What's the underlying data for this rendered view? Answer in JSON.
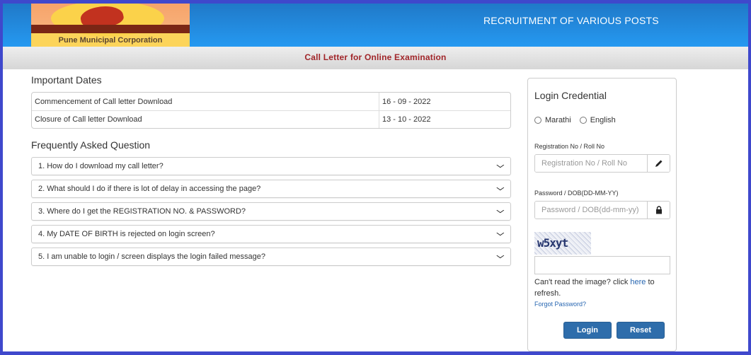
{
  "header": {
    "logo_caption": "Pune Municipal Corporation",
    "title": "RECRUITMENT OF VARIOUS POSTS"
  },
  "subbar": {
    "title": "Call Letter for Online Examination"
  },
  "important_dates": {
    "heading": "Important Dates",
    "rows": [
      {
        "label": "Commencement of Call letter Download",
        "date": "16 - 09 - 2022"
      },
      {
        "label": "Closure of Call letter Download",
        "date": "13 - 10 - 2022"
      }
    ]
  },
  "faq": {
    "heading": "Frequently Asked Question",
    "items": [
      {
        "question": "1. How do I download my call letter?",
        "icon": "chevron-down-icon"
      },
      {
        "question": "2. What should I do if there is lot of delay in accessing the page?",
        "icon": "chevron-down-icon"
      },
      {
        "question": "3. Where do I get the REGISTRATION NO. & PASSWORD?",
        "icon": "chevron-down-icon"
      },
      {
        "question": "4. My DATE OF BIRTH is rejected on login screen?",
        "icon": "chevron-down-icon"
      },
      {
        "question": "5. I am unable to login / screen displays the login failed message?",
        "icon": "chevron-down-icon"
      }
    ]
  },
  "login": {
    "heading": "Login Credential",
    "languages": [
      "Marathi",
      "English"
    ],
    "registration": {
      "label": "Registration No / Roll No",
      "placeholder": "Registration No / Roll No",
      "value": "",
      "icon": "pencil-icon"
    },
    "password": {
      "label": "Password / DOB(DD-MM-YY)",
      "placeholder": "Password / DOB(dd-mm-yy)",
      "value": "",
      "icon": "lock-icon"
    },
    "captcha_text": "w5xyt",
    "captcha_value": "",
    "help_prefix": "Can't read the image? click ",
    "help_link": "here",
    "help_suffix": " to refresh.",
    "forgot_password": "Forgot Password?",
    "login_button": "Login",
    "reset_button": "Reset"
  }
}
